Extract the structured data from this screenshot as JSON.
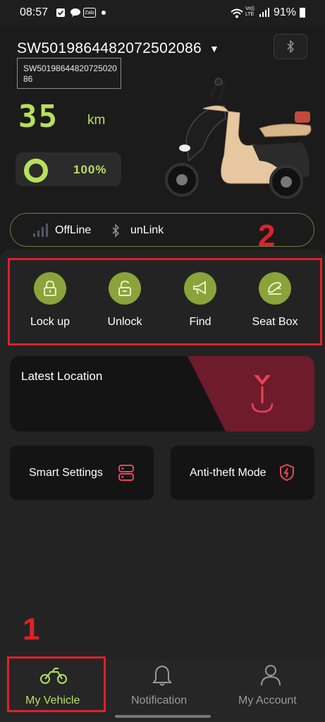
{
  "status_bar": {
    "time": "08:57",
    "battery": "91%",
    "icons": [
      "calendar-check-icon",
      "chat-bubble-icon",
      "zalo-icon",
      "dot-icon",
      "wifi-icon",
      "volte-lte-icon",
      "signal-icon",
      "battery-icon"
    ],
    "zalo_label": "Zalo",
    "volte_label": "Vo)) LTE"
  },
  "vehicle": {
    "id": "SW5019864482072502086",
    "tooltip": "SW5019864482072502086",
    "range_value": "35",
    "range_unit": "km",
    "battery_percent": "100%",
    "battery_level": 1.0
  },
  "connection": {
    "network_status": "OffLine",
    "bluetooth_status": "unLink"
  },
  "annotations": {
    "marker_1": "1",
    "marker_2": "2"
  },
  "actions": [
    {
      "label": "Lock up",
      "icon": "lock-icon"
    },
    {
      "label": "Unlock",
      "icon": "unlock-icon"
    },
    {
      "label": "Find",
      "icon": "horn-icon"
    },
    {
      "label": "Seat Box",
      "icon": "seat-icon"
    }
  ],
  "location": {
    "title": "Latest Location",
    "icon": "brand-pin-icon"
  },
  "cards": {
    "smart_settings": "Smart Settings",
    "anti_theft": "Anti-theft Mode"
  },
  "nav": {
    "vehicle": "My Vehicle",
    "notification": "Notification",
    "account": "My Account"
  },
  "colors": {
    "accent": "#b7e05a",
    "action_circle": "#8aa33a",
    "annotation": "#e0202a",
    "location_accent": "#6e1b2b"
  }
}
